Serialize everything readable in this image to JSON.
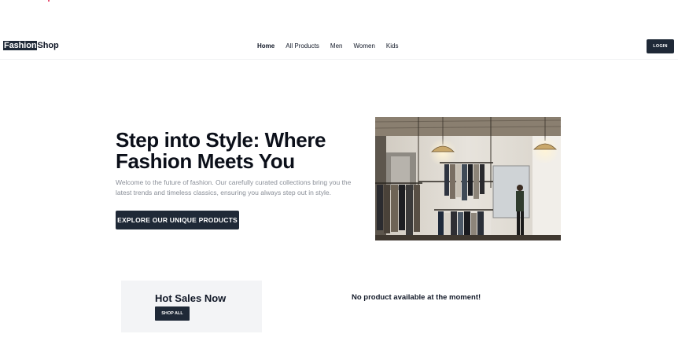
{
  "header": {
    "logo_highlight": "Fashion",
    "logo_rest": "Shop",
    "nav": [
      "Home",
      "All Products",
      "Men",
      "Women",
      "Kids"
    ],
    "login_label": "LOGIN"
  },
  "hero": {
    "title": "Step into Style: Where Fashion Meets You",
    "description": "Welcome to the future of fashion. Our carefully curated collections bring you the latest trends and timeless classics, ensuring you always step out in style.",
    "cta_label": "EXPLORE OUR UNIQUE PRODUCTS"
  },
  "hot_sales": {
    "title": "Hot Sales Now",
    "button_label": "SHOP ALL"
  },
  "products": {
    "empty_message": "No product available at the moment!"
  },
  "colors": {
    "primary": "#1f2937",
    "card_bg": "#f3f4f6",
    "muted_text": "#8a8f98"
  }
}
